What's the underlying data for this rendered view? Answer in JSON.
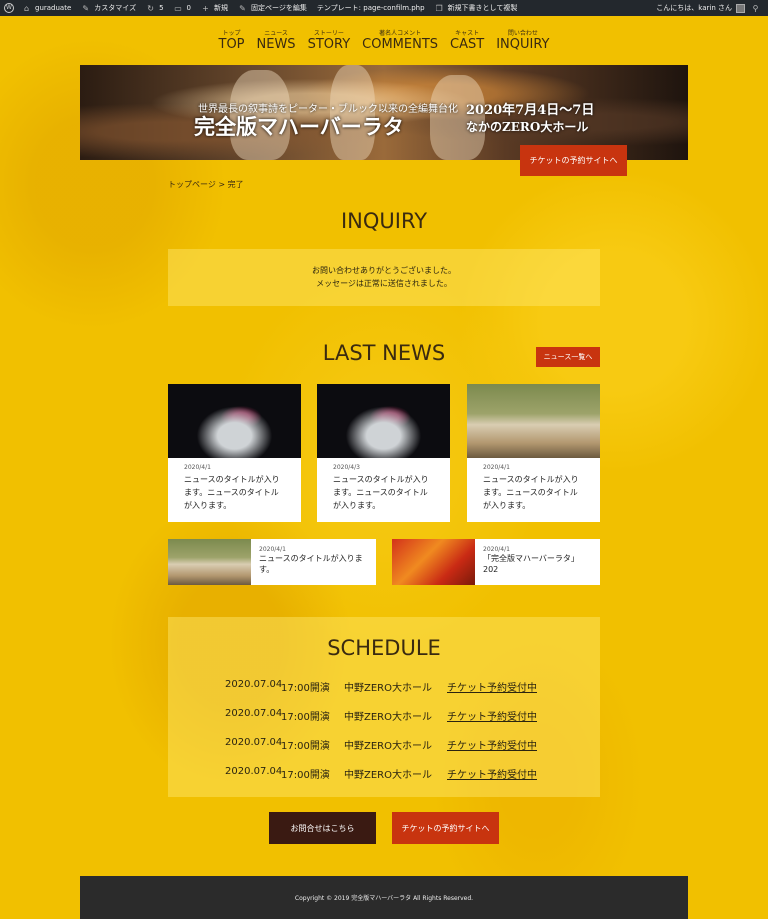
{
  "adminbar": {
    "site": "guraduate",
    "customize": "カスタマイズ",
    "updates": "5",
    "comments": "0",
    "new": "新規",
    "edit_page": "固定ページを編集",
    "template": "テンプレート: page-confilm.php",
    "duplicate": "新規下書きとして複製",
    "greeting": "こんにちは、karin さん"
  },
  "nav": [
    {
      "sub": "トップ",
      "main": "TOP"
    },
    {
      "sub": "ニュース",
      "main": "NEWS"
    },
    {
      "sub": "ストーリー",
      "main": "STORY"
    },
    {
      "sub": "著名人コメント",
      "main": "COMMENTS"
    },
    {
      "sub": "キャスト",
      "main": "CAST"
    },
    {
      "sub": "問い合わせ",
      "main": "INQUIRY"
    }
  ],
  "hero": {
    "catch": "世界最長の叙事詩をピーター・ブルック以来の全編舞台化",
    "title": "完全版マハーバーラタ",
    "date": "2020年7月4日〜7日",
    "venue": "なかのZERO大ホール",
    "ticket": "チケットの予約サイトへ"
  },
  "breadcrumb": "トップページ > 完了",
  "inquiry": {
    "title": "INQUIRY",
    "msg1": "お問い合わせありがとうございました。",
    "msg2": "メッセージは正常に送信されました。"
  },
  "news": {
    "title": "LAST NEWS",
    "all_button": "ニュース一覧へ",
    "cards": [
      {
        "date": "2020/4/1",
        "title": "ニュースのタイトルが入ります。ニュースのタイトルが入ります。"
      },
      {
        "date": "2020/4/3",
        "title": "ニュースのタイトルが入ります。ニュースのタイトルが入ります。"
      },
      {
        "date": "2020/4/1",
        "title": "ニュースのタイトルが入ります。ニュースのタイトルが入ります。"
      }
    ],
    "small": [
      {
        "date": "2020/4/1",
        "title": "ニュースのタイトルが入ります。"
      },
      {
        "date": "2020/4/1",
        "title": "「完全版マハーバーラタ」202"
      }
    ]
  },
  "schedule": {
    "title": "SCHEDULE",
    "rows": [
      {
        "date": "2020.07.04",
        "time": "17:00開演",
        "venue": "中野ZERO大ホール",
        "link": "チケット予約受付中"
      },
      {
        "date": "2020.07.04",
        "time": "17:00開演",
        "venue": "中野ZERO大ホール",
        "link": "チケット予約受付中"
      },
      {
        "date": "2020.07.04",
        "time": "17:00開演",
        "venue": "中野ZERO大ホール",
        "link": "チケット予約受付中"
      },
      {
        "date": "2020.07.04",
        "time": "17:00開演",
        "venue": "中野ZERO大ホール",
        "link": "チケット予約受付中"
      }
    ]
  },
  "buttons": {
    "contact": "お問合せはこちら",
    "ticket": "チケットの予約サイトへ"
  },
  "footer": "Copyright © 2019 完全版マハーバーラタ All Rights Reserved."
}
